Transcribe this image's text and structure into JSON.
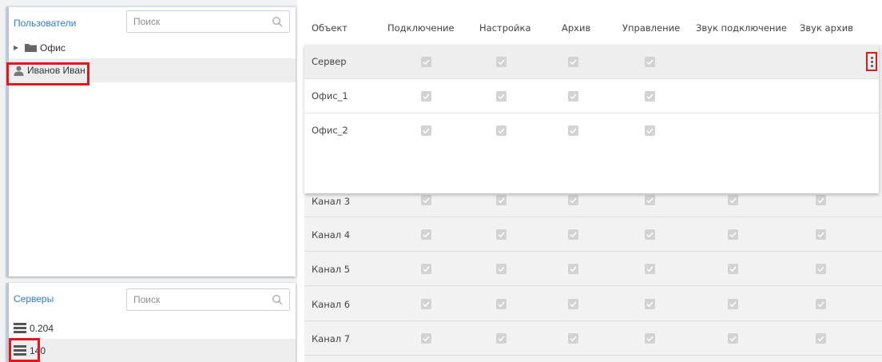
{
  "users_panel": {
    "title": "Пользователи",
    "search_placeholder": "Поиск",
    "tree": [
      {
        "label": "Офис",
        "icon": "folder-icon"
      },
      {
        "label": "Иванов Иван",
        "icon": "user-icon",
        "selected": true
      }
    ]
  },
  "servers_panel": {
    "title": "Серверы",
    "search_placeholder": "Поиск",
    "items": [
      {
        "label": "0.204",
        "icon": "server-icon"
      },
      {
        "label": "140",
        "icon": "server-icon",
        "selected": true
      }
    ]
  },
  "table": {
    "columns": [
      "Объект",
      "Подключение",
      "Настройка",
      "Архив",
      "Управление",
      "Звук подключение",
      "Звук архив"
    ],
    "popup_rows": [
      {
        "name": "Сервер",
        "checks": [
          true,
          true,
          true,
          true
        ]
      },
      {
        "name": "Офис_1",
        "checks": [
          true,
          true,
          true,
          true
        ]
      },
      {
        "name": "Офис_2",
        "checks": [
          true,
          true,
          true,
          true
        ]
      }
    ],
    "rows": [
      {
        "name": "Канал 3",
        "checks": [
          true,
          true,
          true,
          true,
          true,
          true
        ]
      },
      {
        "name": "Канал 4",
        "checks": [
          true,
          true,
          true,
          true,
          true,
          true
        ]
      },
      {
        "name": "Канал 5",
        "checks": [
          true,
          true,
          true,
          true,
          true,
          true
        ]
      },
      {
        "name": "Канал 6",
        "checks": [
          true,
          true,
          true,
          true,
          true,
          true
        ]
      },
      {
        "name": "Канал 7",
        "checks": [
          true,
          true,
          true,
          true,
          true,
          true
        ]
      }
    ]
  },
  "colors": {
    "accent": "#2e7bd6",
    "highlight": "#e8141b",
    "checkbox": "#d3d3d3"
  }
}
